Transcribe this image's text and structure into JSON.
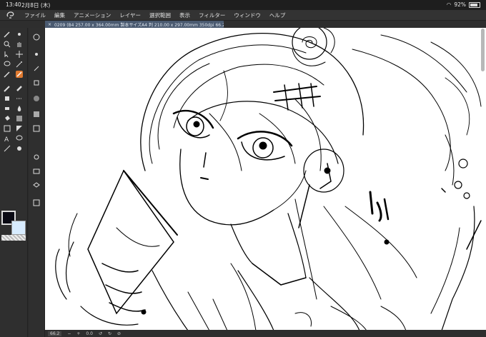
{
  "status_bar": {
    "time": "13:40",
    "date": "2月8日 (木)",
    "battery": "92%"
  },
  "menu": [
    "ファイル",
    "編集",
    "アニメーション",
    "レイヤー",
    "選択範囲",
    "表示",
    "フィルター",
    "ウィンドウ",
    "ヘルプ"
  ],
  "document_tab": {
    "title": "0209 (B4 257.00 x 364.00mm 製本サイズA4 判 210.00 x 297.00mm 350dpi 66.2%)"
  },
  "bottom_bar": {
    "zoom": "66.2",
    "minus": "−",
    "plus": "+",
    "angle": "0.0"
  },
  "colors": {
    "main": "#0a0a14",
    "sub": "#d8ecff",
    "accent": "#e07a30"
  },
  "canvas": {
    "content": "line art sketch of anime character"
  }
}
